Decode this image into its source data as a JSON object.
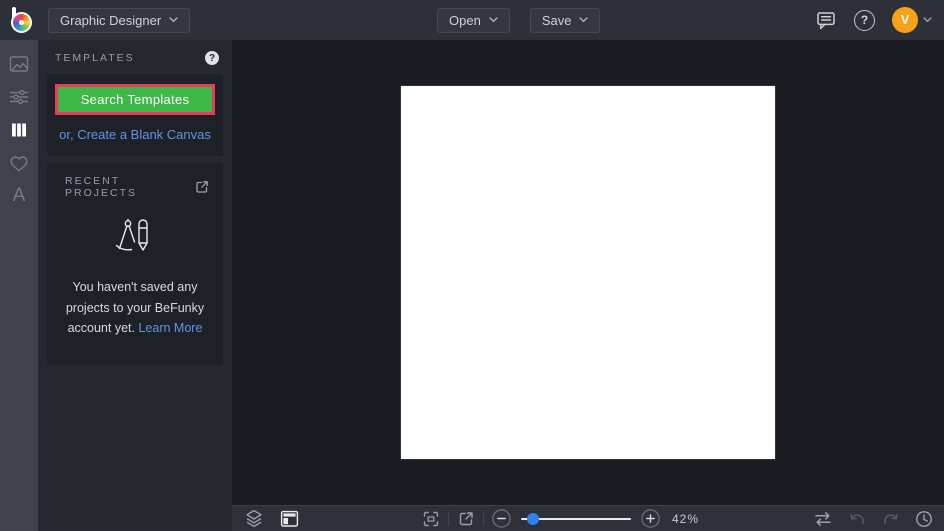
{
  "topbar": {
    "app_menu_label": "Graphic Designer",
    "open_label": "Open",
    "save_label": "Save",
    "help_symbol": "?",
    "avatar_initial": "V"
  },
  "sidebar": {
    "text_tool_glyph": "A"
  },
  "panel": {
    "templates_header": "TEMPLATES",
    "help_symbol": "?",
    "search_button_label": "Search Templates",
    "blank_canvas_link": "or, Create a Blank Canvas",
    "recent_header": "RECENT PROJECTS",
    "empty_line1": "You haven't saved any",
    "empty_line2": "projects to your BeFunky",
    "empty_line3": "account yet.",
    "learn_more_label": "Learn More"
  },
  "toolbar": {
    "zoom_level": "42%"
  },
  "colors": {
    "button_green": "#3eb847",
    "highlight_frame_red": "#ea3a5e",
    "link_blue": "#5d95e8",
    "avatar_orange": "#f7a219",
    "slider_thumb_blue": "#2f84ea"
  }
}
